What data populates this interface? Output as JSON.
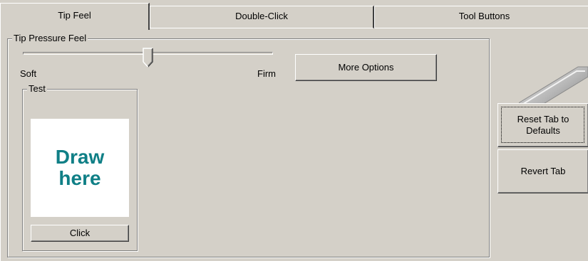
{
  "tabs": [
    {
      "label": "Tip Feel",
      "active": true
    },
    {
      "label": "Double-Click",
      "active": false
    },
    {
      "label": "Tool Buttons",
      "active": false
    }
  ],
  "tip_pressure": {
    "group_label": "Tip Pressure Feel",
    "slider_min_label": "Soft",
    "slider_max_label": "Firm",
    "slider_value_fraction": 0.5,
    "more_options_label": "More Options"
  },
  "test": {
    "group_label": "Test",
    "draw_area_text": "Draw\nhere",
    "click_label": "Click"
  },
  "side": {
    "pen_icon": "pen-tablet-icon",
    "reset_label": "Reset Tab to Defaults",
    "revert_label": "Revert Tab"
  },
  "colors": {
    "background": "#d4d0c8",
    "draw_text": "#0f7f86"
  }
}
